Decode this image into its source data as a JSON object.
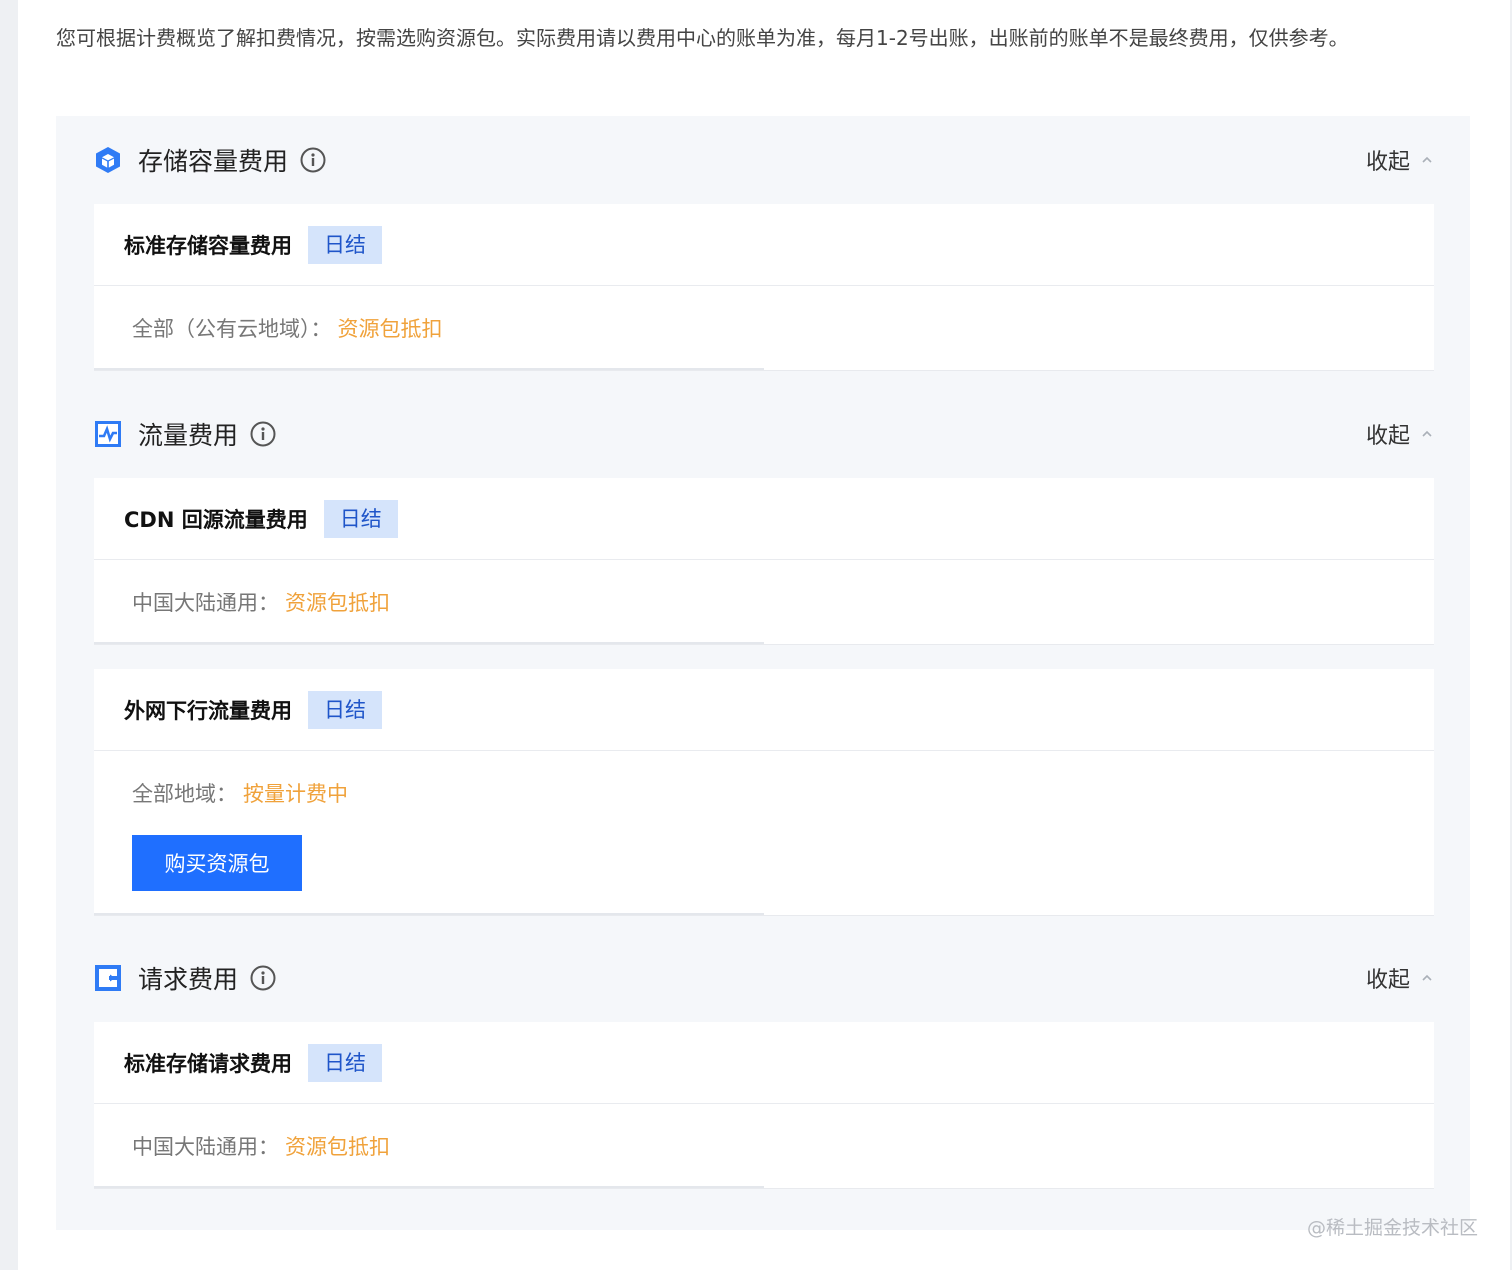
{
  "intro_text": "您可根据计费概览了解扣费情况，按需选购资源包。实际费用请以费用中心的账单为准，每月1-2号出账，出账前的账单不是最终费用，仅供参考。",
  "collapse_label": "收起",
  "sections": [
    {
      "title": "存储容量费用",
      "icon": "cube-icon",
      "cards": [
        {
          "title": "标准存储容量费用",
          "tag": "日结",
          "row_label": "全部（公有云地域）：",
          "row_value": "资源包抵扣"
        }
      ]
    },
    {
      "title": "流量费用",
      "icon": "traffic-chart-icon",
      "cards": [
        {
          "title": "CDN 回源流量费用",
          "tag": "日结",
          "row_label": "中国大陆通用：",
          "row_value": "资源包抵扣"
        },
        {
          "title": "外网下行流量费用",
          "tag": "日结",
          "row_label": "全部地域：",
          "row_value": "按量计费中",
          "button": "购买资源包"
        }
      ]
    },
    {
      "title": "请求费用",
      "icon": "request-icon",
      "cards": [
        {
          "title": "标准存储请求费用",
          "tag": "日结",
          "row_label": "中国大陆通用：",
          "row_value": "资源包抵扣"
        }
      ]
    }
  ],
  "watermark": "@稀土掘金技术社区",
  "colors": {
    "accent": "#1f6fff",
    "tag_bg": "#d5e4fb",
    "warning": "#f0a23b"
  }
}
